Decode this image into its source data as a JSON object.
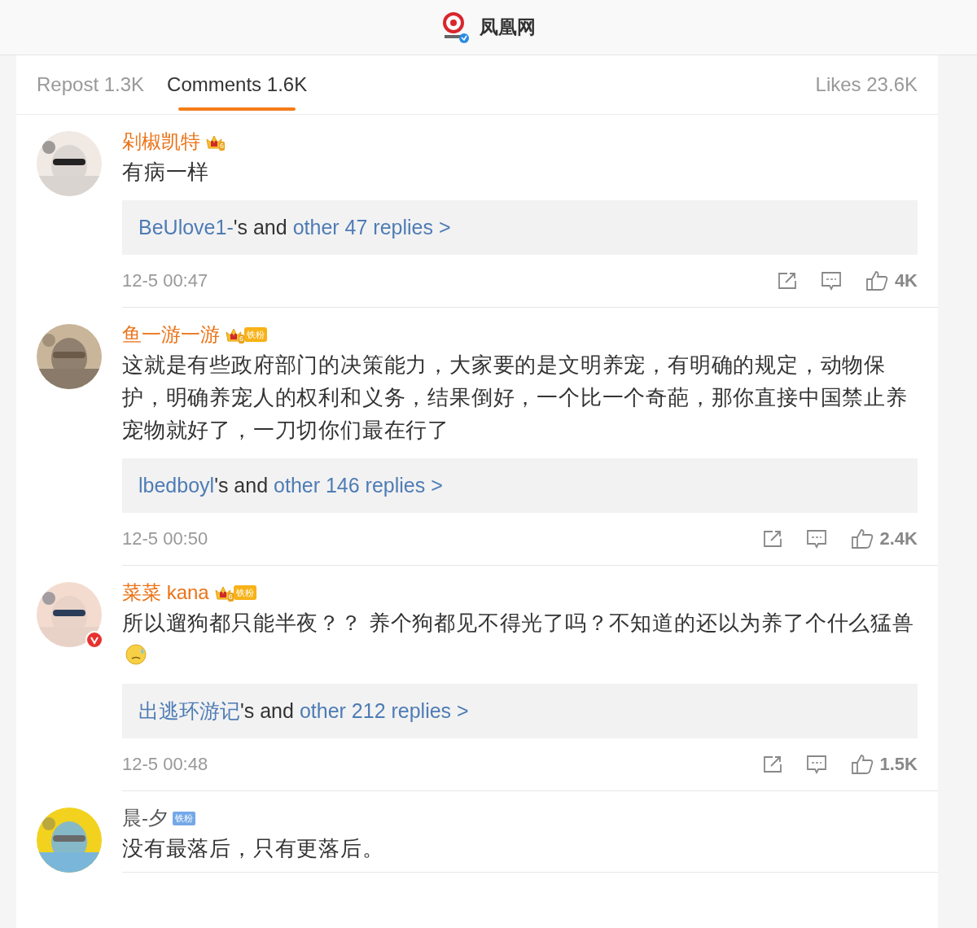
{
  "header": {
    "title": "凤凰网"
  },
  "tabs": [
    {
      "label": "Repost 1.3K",
      "selected": false
    },
    {
      "label": "Comments 1.6K",
      "selected": true
    },
    {
      "label": "Likes 23.6K",
      "selected": false
    }
  ],
  "comments": [
    {
      "user": "剁椒凯特",
      "vip": true,
      "badge": {
        "kind": "crown",
        "level": "6"
      },
      "verified": false,
      "text": "有病一样",
      "emoji": false,
      "reply": {
        "user": "BeUlove1-",
        "mid": "'s and ",
        "more": "other 47 replies >"
      },
      "time": "12-5 00:47",
      "likes": "4K"
    },
    {
      "user": "鱼一游一游",
      "vip": true,
      "badge": {
        "kind": "crown-fan",
        "level": "6",
        "label": "铁粉"
      },
      "verified": false,
      "text": "这就是有些政府部门的决策能力，大家要的是文明养宠，有明确的规定，动物保护，明确养宠人的权利和义务，结果倒好，一个比一个奇葩，那你直接中国禁止养宠物就好了，一刀切你们最在行了",
      "emoji": false,
      "reply": {
        "user": "lbedboyl",
        "mid": "'s and ",
        "more": "other 146 replies >"
      },
      "time": "12-5 00:50",
      "likes": "2.4K"
    },
    {
      "user": "菜菜 kana",
      "vip": true,
      "badge": {
        "kind": "crown-fan",
        "level": "6",
        "label": "铁粉"
      },
      "verified": true,
      "text": "所以遛狗都只能半夜？？ 养个狗都见不得光了吗？不知道的还以为养了个什么猛兽",
      "emoji": true,
      "reply": {
        "user": "出逃环游记",
        "mid": "'s and ",
        "more": "other 212 replies >"
      },
      "time": "12-5 00:48",
      "likes": "1.5K"
    },
    {
      "user": "晨-夕",
      "vip": false,
      "badge": {
        "kind": "fan",
        "label": "铁粉"
      },
      "verified": false,
      "text": "没有最落后，只有更落后。",
      "emoji": false
    }
  ]
}
